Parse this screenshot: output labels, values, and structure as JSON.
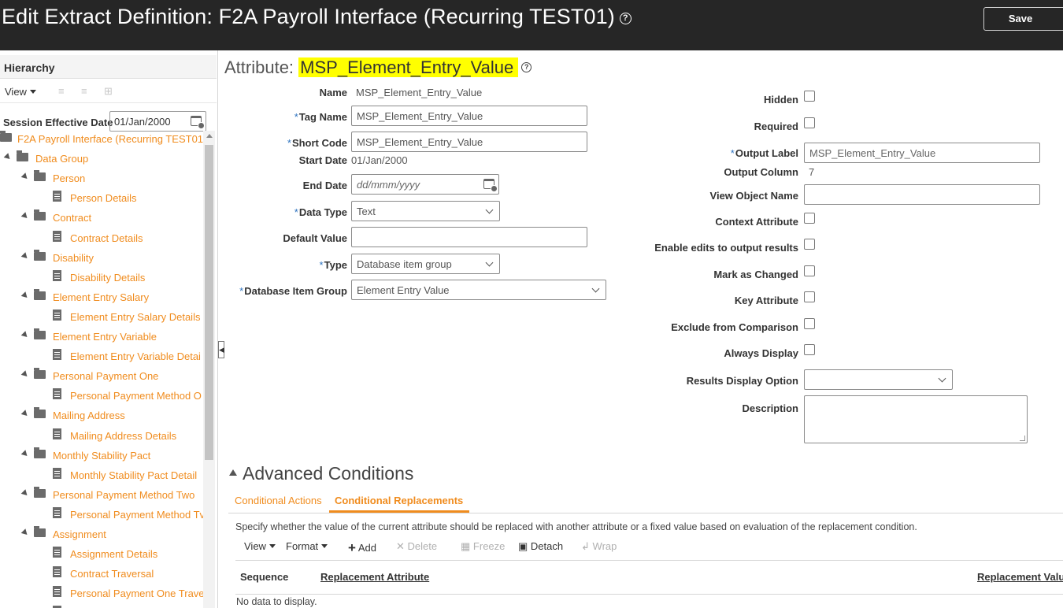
{
  "header": {
    "title": "Edit Extract Definition: F2A Payroll Interface (Recurring TEST01)",
    "save_label": "Save"
  },
  "hierarchy": {
    "title": "Hierarchy",
    "view_label": "View",
    "session_label": "Session Effective Date",
    "session_date": "01/Jan/2000",
    "tree": [
      {
        "label": "F2A Payroll Interface (Recurring TEST01)",
        "level": 0,
        "kind": "folder"
      },
      {
        "label": "Data Group",
        "level": 1,
        "kind": "folder"
      },
      {
        "label": "Person",
        "level": 2,
        "kind": "folder"
      },
      {
        "label": "Person Details",
        "level": 3,
        "kind": "doc"
      },
      {
        "label": "Contract",
        "level": 2,
        "kind": "folder"
      },
      {
        "label": "Contract Details",
        "level": 3,
        "kind": "doc"
      },
      {
        "label": "Disability",
        "level": 2,
        "kind": "folder"
      },
      {
        "label": "Disability Details",
        "level": 3,
        "kind": "doc"
      },
      {
        "label": "Element Entry Salary",
        "level": 2,
        "kind": "folder"
      },
      {
        "label": "Element Entry Salary Details",
        "level": 3,
        "kind": "doc"
      },
      {
        "label": "Element Entry Variable",
        "level": 2,
        "kind": "folder"
      },
      {
        "label": "Element Entry Variable Detai",
        "level": 3,
        "kind": "doc"
      },
      {
        "label": "Personal Payment One",
        "level": 2,
        "kind": "folder"
      },
      {
        "label": "Personal Payment Method O",
        "level": 3,
        "kind": "doc"
      },
      {
        "label": "Mailing Address",
        "level": 2,
        "kind": "folder"
      },
      {
        "label": "Mailing Address Details",
        "level": 3,
        "kind": "doc"
      },
      {
        "label": "Monthly Stability Pact",
        "level": 2,
        "kind": "folder"
      },
      {
        "label": "Monthly Stability Pact Detail",
        "level": 3,
        "kind": "doc"
      },
      {
        "label": "Personal Payment Method Two",
        "level": 2,
        "kind": "folder"
      },
      {
        "label": "Personal Payment Method Tv",
        "level": 3,
        "kind": "doc"
      },
      {
        "label": "Assignment",
        "level": 2,
        "kind": "folder"
      },
      {
        "label": "Assignment Details",
        "level": 3,
        "kind": "doc"
      },
      {
        "label": "Contract Traversal",
        "level": 3,
        "kind": "doc"
      },
      {
        "label": "Personal Payment One Trave",
        "level": 3,
        "kind": "doc"
      },
      {
        "label": "",
        "level": 3,
        "kind": "doc"
      }
    ]
  },
  "attribute": {
    "prefix": "Attribute:",
    "name_highlight": "MSP_Element_Entry_Value",
    "left": {
      "name_label": "Name",
      "name_value": "MSP_Element_Entry_Value",
      "tag_name_label": "Tag Name",
      "tag_name_value": "MSP_Element_Entry_Value",
      "short_code_label": "Short Code",
      "short_code_value": "MSP_Element_Entry_Value",
      "start_date_label": "Start Date",
      "start_date_value": "01/Jan/2000",
      "end_date_label": "End Date",
      "end_date_placeholder": "dd/mmm/yyyy",
      "data_type_label": "Data Type",
      "data_type_value": "Text",
      "default_value_label": "Default Value",
      "default_value_value": "",
      "type_label": "Type",
      "type_value": "Database item group",
      "db_item_group_label": "Database Item Group",
      "db_item_group_value": "Element Entry Value"
    },
    "right": {
      "hidden_label": "Hidden",
      "required_label": "Required",
      "output_label_label": "Output Label",
      "output_label_value": "MSP_Element_Entry_Value",
      "output_column_label": "Output Column",
      "output_column_value": "7",
      "view_object_label": "View Object Name",
      "view_object_value": "",
      "context_attr_label": "Context Attribute",
      "enable_edits_label": "Enable edits to output results",
      "mark_changed_label": "Mark as Changed",
      "key_attr_label": "Key Attribute",
      "exclude_label": "Exclude from Comparison",
      "always_display_label": "Always Display",
      "results_display_label": "Results Display Option",
      "results_display_value": "",
      "description_label": "Description",
      "description_value": ""
    }
  },
  "advanced": {
    "title": "Advanced Conditions",
    "tabs": [
      {
        "label": "Conditional Actions",
        "active": false
      },
      {
        "label": "Conditional Replacements",
        "active": true
      }
    ],
    "description": "Specify whether the value of the current attribute should be replaced with another attribute or a fixed value based on evaluation of the replacement condition.",
    "toolbar": {
      "view": "View",
      "format": "Format",
      "add": "Add",
      "delete": "Delete",
      "freeze": "Freeze",
      "detach": "Detach",
      "wrap": "Wrap"
    },
    "columns": [
      "Sequence",
      "Replacement Attribute",
      "Replacement Valu"
    ],
    "empty_text": "No data to display."
  },
  "colors": {
    "accent": "#f08c1e",
    "header_bg": "#262626",
    "highlight": "#ffff00",
    "required_marker": "#2f74c0"
  },
  "icons": {
    "calendar": "calendar-icon",
    "folder": "folder-icon",
    "document": "document-icon",
    "help": "help-icon"
  }
}
